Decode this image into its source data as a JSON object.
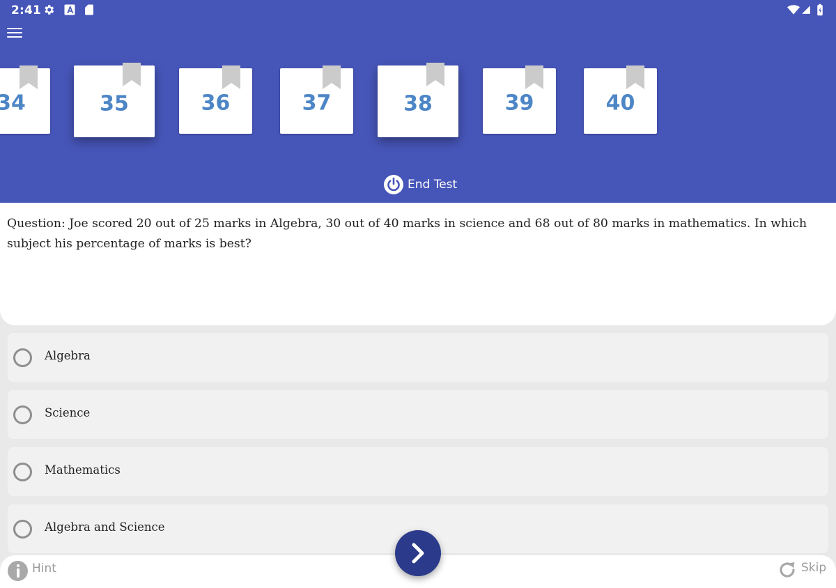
{
  "status_bar": {
    "time": "2:41",
    "icons": [
      "gear-icon",
      "a-box-icon",
      "sd-card-icon",
      "wifi-icon",
      "signal-icon",
      "battery-icon"
    ]
  },
  "header": {
    "background_color": "#4655b8",
    "question_numbers": [
      "34",
      "35",
      "36",
      "37",
      "38",
      "39",
      "40"
    ],
    "end_test_label": "End Test"
  },
  "question": {
    "text": "Question: Joe scored 20 out of 25 marks in Algebra, 30 out of 40 marks in science and 68 out of 80 marks in mathematics. In which subject his percentage of marks is best?"
  },
  "options": [
    {
      "label": "Algebra",
      "selected": false
    },
    {
      "label": "Science",
      "selected": false
    },
    {
      "label": "Mathematics",
      "selected": false
    },
    {
      "label": "Algebra and Science",
      "selected": false
    }
  ],
  "footer": {
    "hint_label": "Hint",
    "skip_label": "Skip",
    "next_button_color": "#2b3a8a"
  }
}
